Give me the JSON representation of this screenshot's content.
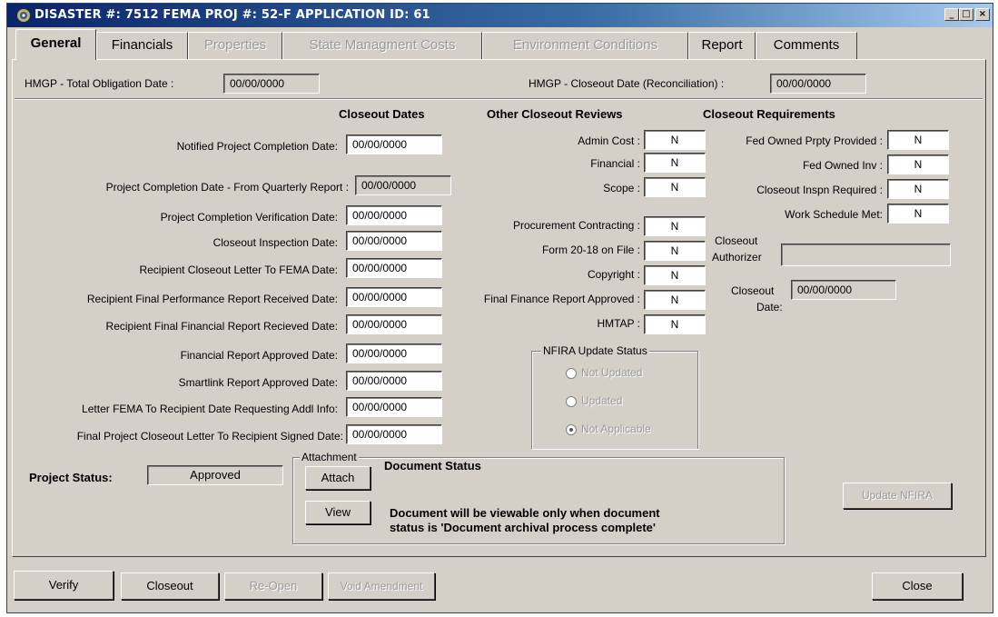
{
  "window": {
    "title": "DISASTER #: 7512  FEMA PROJ #: 52-F  APPLICATION ID: 61",
    "min": "_",
    "max": "□",
    "close": "×"
  },
  "tabs": [
    {
      "label": "General",
      "state": "active"
    },
    {
      "label": "Financials",
      "state": "enabled"
    },
    {
      "label": "Properties",
      "state": "disabled"
    },
    {
      "label": "State Managment Costs",
      "state": "disabled"
    },
    {
      "label": "Environment Conditions",
      "state": "disabled"
    },
    {
      "label": "Report",
      "state": "enabled"
    },
    {
      "label": "Comments",
      "state": "enabled"
    }
  ],
  "top": {
    "total_obligation_label": "HMGP - Total Obligation Date :",
    "total_obligation_value": "00/00/0000",
    "closeout_reconciliation_label": "HMGP - Closeout Date (Reconciliation) :",
    "closeout_reconciliation_value": "00/00/0000"
  },
  "closeout_dates": {
    "header": "Closeout Dates",
    "rows": [
      {
        "label": "Notified Project  Completion Date:",
        "value": "00/00/0000"
      },
      {
        "label": "Project Completion Date - From Quarterly Report :",
        "value": "00/00/0000"
      },
      {
        "label": "Project Completion Verification Date:",
        "value": "00/00/0000"
      },
      {
        "label": "Closeout Inspection Date:",
        "value": "00/00/0000"
      },
      {
        "label": "Recipient Closeout  Letter To FEMA Date:",
        "value": "00/00/0000"
      },
      {
        "label": "Recipient Final Performance Report Received  Date:",
        "value": "00/00/0000"
      },
      {
        "label": "Recipient Final Financial Report Recieved Date:",
        "value": "00/00/0000"
      },
      {
        "label": "Financial Report Approved Date:",
        "value": "00/00/0000"
      },
      {
        "label": "Smartlink Report Approved Date:",
        "value": "00/00/0000"
      },
      {
        "label": "Letter FEMA To Recipient Date Requesting Addl Info:",
        "value": "00/00/0000"
      },
      {
        "label": "Final Project Closeout Letter To Recipient Signed Date:",
        "value": "00/00/0000"
      }
    ]
  },
  "other_reviews": {
    "header": "Other Closeout Reviews",
    "rows": [
      {
        "label": "Admin Cost :",
        "value": "N"
      },
      {
        "label": "Financial :",
        "value": "N"
      },
      {
        "label": "Scope :",
        "value": "N"
      },
      {
        "label": "Procurement Contracting  :",
        "value": "N"
      },
      {
        "label": "Form 20-18 on File :",
        "value": "N"
      },
      {
        "label": "Copyright :",
        "value": "N"
      },
      {
        "label": "Final Finance Report Approved :",
        "value": "N"
      },
      {
        "label": "HMTAP :",
        "value": "N"
      }
    ]
  },
  "requirements": {
    "header": "Closeout Requirements",
    "rows": [
      {
        "label": "Fed Owned Prpty Provided :",
        "value": "N"
      },
      {
        "label": "Fed Owned Inv :",
        "value": "N"
      },
      {
        "label": "Closeout Inspn Required :",
        "value": "N"
      },
      {
        "label": "Work Schedule Met:",
        "value": "N"
      }
    ],
    "authorizer_label_1": "Closeout",
    "authorizer_label_2": "Authorizer",
    "authorizer_value": "",
    "date_label_1": "Closeout",
    "date_label_2": "Date:",
    "date_value": "00/00/0000"
  },
  "nfira": {
    "title": "NFIRA Update Status",
    "options": [
      "Not Updated",
      "Updated",
      "Not Applicable"
    ],
    "selected": "Not Applicable",
    "update_button": "Update NFIRA"
  },
  "project_status": {
    "label": "Project Status:",
    "value": "Approved"
  },
  "attachment": {
    "group_title": "Attachment",
    "attach_button": "Attach",
    "view_button": "View",
    "doc_status_label": "Document Status",
    "note_line1": "Document will be viewable only when document",
    "note_line2": "status is 'Document archival process complete'"
  },
  "footer": {
    "verify": "Verify",
    "closeout": "Closeout",
    "reopen": "Re-Open",
    "void": "Void Amendment",
    "close": "Close"
  }
}
